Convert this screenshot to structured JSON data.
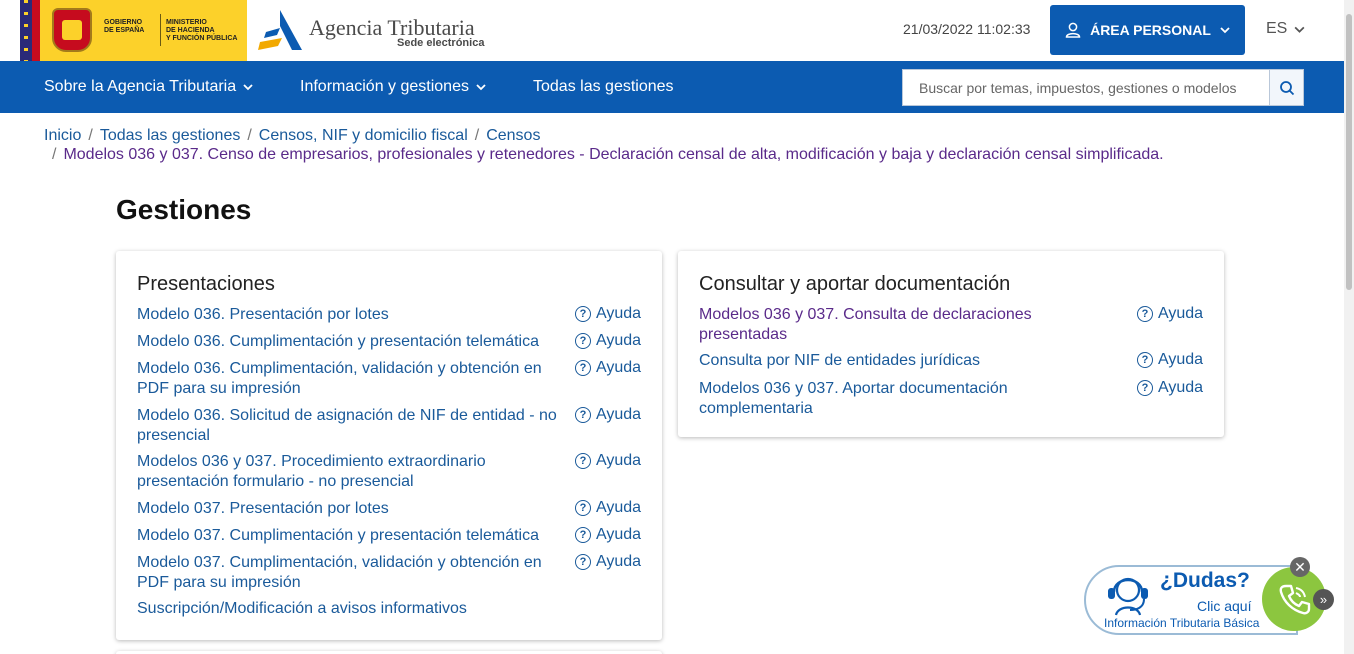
{
  "header": {
    "gov_label": "GOBIERNO\nDE ESPAÑA",
    "ministry_label": "MINISTERIO\nDE HACIENDA\nY FUNCIÓN PÚBLICA",
    "agency_name": "Agencia Tributaria",
    "agency_sub": "Sede electrónica",
    "datetime": "21/03/2022 11:02:33",
    "area_personal": "ÁREA PERSONAL",
    "language": "ES"
  },
  "nav": {
    "items": [
      {
        "label": "Sobre la Agencia Tributaria",
        "dropdown": true
      },
      {
        "label": "Información y gestiones",
        "dropdown": true
      },
      {
        "label": "Todas las gestiones",
        "dropdown": false
      }
    ],
    "search_placeholder": "Buscar por temas, impuestos, gestiones o modelos"
  },
  "breadcrumb": {
    "items": [
      "Inicio",
      "Todas las gestiones",
      "Censos, NIF y domicilio fiscal",
      "Censos"
    ],
    "current": "Modelos 036 y 037. Censo de empresarios, profesionales y retenedores - Declaración censal de alta, modificación y baja y declaración censal simplificada."
  },
  "page_title": "Gestiones",
  "cards": {
    "presentaciones": {
      "title": "Presentaciones",
      "rows": [
        {
          "label": "Modelo 036. Presentación por lotes",
          "help": "Ayuda"
        },
        {
          "label": "Modelo 036. Cumplimentación y presentación telemática",
          "help": "Ayuda"
        },
        {
          "label": "Modelo 036. Cumplimentación, validación y obtención en PDF para su impresión",
          "help": "Ayuda"
        },
        {
          "label": "Modelo 036. Solicitud de asignación de NIF de entidad - no presencial",
          "help": "Ayuda"
        },
        {
          "label": "Modelos 036 y 037. Procedimiento extraordinario presentación formulario - no presencial",
          "help": "Ayuda"
        },
        {
          "label": "Modelo 037. Presentación por lotes",
          "help": "Ayuda"
        },
        {
          "label": "Modelo 037. Cumplimentación y presentación telemática",
          "help": "Ayuda"
        },
        {
          "label": "Modelo 037. Cumplimentación, validación y obtención en PDF para su impresión",
          "help": "Ayuda"
        },
        {
          "label": "Suscripción/Modificación a avisos informativos",
          "help": ""
        }
      ]
    },
    "consultar": {
      "title": "Consultar y aportar documentación",
      "rows": [
        {
          "label": "Modelos 036 y 037. Consulta de declaraciones presentadas",
          "help": "Ayuda"
        },
        {
          "label": "Consulta por NIF de entidades jurídicas",
          "help": "Ayuda"
        },
        {
          "label": "Modelos 036 y 037. Aportar documentación complementaria",
          "help": "Ayuda"
        }
      ]
    }
  },
  "dudas": {
    "title": "¿Dudas?",
    "click": "Clic aquí",
    "info": "Información Tributaria Básica"
  },
  "colors": {
    "brand_blue": "#0c5bb1",
    "link": "#1a5a9a",
    "visited_link": "#5a2a8a",
    "gov_yellow": "#fcd12a",
    "phone_green": "#8cc63f"
  }
}
